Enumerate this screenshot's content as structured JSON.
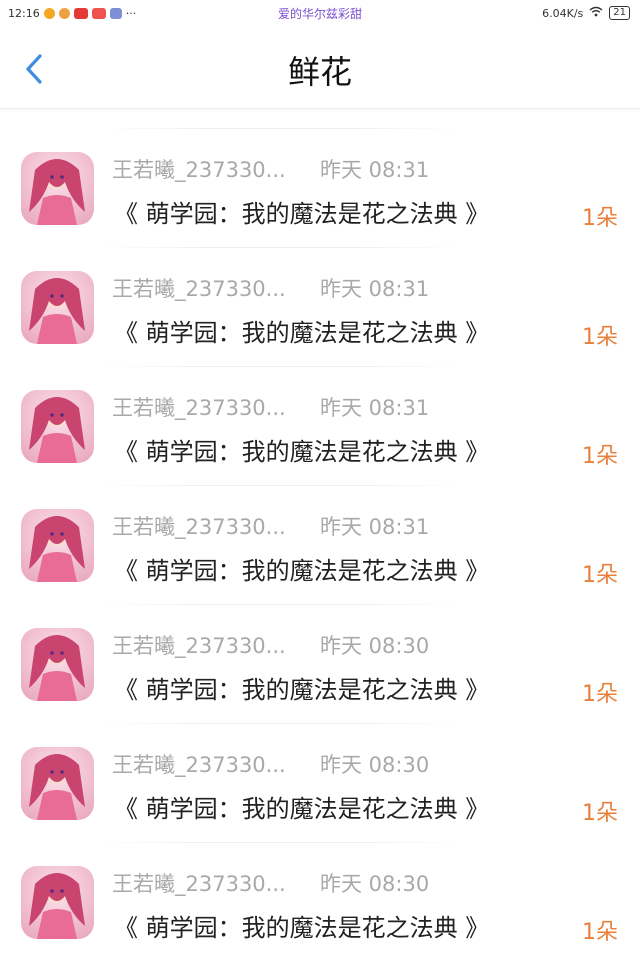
{
  "status_bar": {
    "time": "12:16",
    "dots": "···",
    "center_text": "爱的华尔兹彩甜",
    "network_speed": "6.04K/s",
    "battery": "21"
  },
  "header": {
    "title": "鲜花"
  },
  "records": [
    {
      "user": "王若曦_237330...",
      "time": "昨天 08:31",
      "book": "《 萌学园：我的魔法是花之法典 》",
      "amount": "1朵"
    },
    {
      "user": "王若曦_237330...",
      "time": "昨天 08:31",
      "book": "《 萌学园：我的魔法是花之法典 》",
      "amount": "1朵"
    },
    {
      "user": "王若曦_237330...",
      "time": "昨天 08:31",
      "book": "《 萌学园：我的魔法是花之法典 》",
      "amount": "1朵"
    },
    {
      "user": "王若曦_237330...",
      "time": "昨天 08:31",
      "book": "《 萌学园：我的魔法是花之法典 》",
      "amount": "1朵"
    },
    {
      "user": "王若曦_237330...",
      "time": "昨天 08:30",
      "book": "《 萌学园：我的魔法是花之法典 》",
      "amount": "1朵"
    },
    {
      "user": "王若曦_237330...",
      "time": "昨天 08:30",
      "book": "《 萌学园：我的魔法是花之法典 》",
      "amount": "1朵"
    },
    {
      "user": "王若曦_237330...",
      "time": "昨天 08:30",
      "book": "《 萌学园：我的魔法是花之法典 》",
      "amount": "1朵"
    }
  ],
  "colors": {
    "accent_back": "#3d8de0",
    "amount": "#e8803c",
    "muted_text": "#a9a9a9"
  }
}
